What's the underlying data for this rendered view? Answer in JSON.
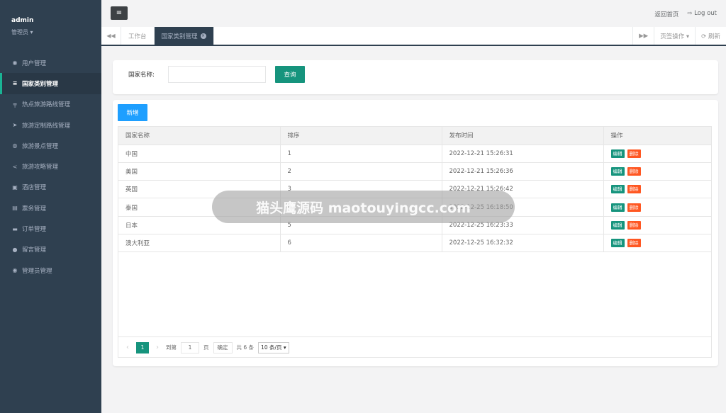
{
  "profile": {
    "name": "admin",
    "role": "管理员 ▾"
  },
  "sidebar": {
    "items": [
      {
        "label": "用户管理",
        "icon": "user-icon",
        "glyph": "◉"
      },
      {
        "label": "国家类别管理",
        "icon": "sliders-icon",
        "glyph": "≡"
      },
      {
        "label": "热点旅游路线管理",
        "icon": "signpost-icon",
        "glyph": "╤"
      },
      {
        "label": "旅游定制路线管理",
        "icon": "paper-plane-icon",
        "glyph": "➤"
      },
      {
        "label": "旅游景点管理",
        "icon": "map-pin-icon",
        "glyph": "◍"
      },
      {
        "label": "旅游攻略管理",
        "icon": "share-icon",
        "glyph": "<"
      },
      {
        "label": "酒店管理",
        "icon": "car-icon",
        "glyph": "▣"
      },
      {
        "label": "票务管理",
        "icon": "id-card-icon",
        "glyph": "▤"
      },
      {
        "label": "订单管理",
        "icon": "credit-card-icon",
        "glyph": "▬"
      },
      {
        "label": "留言管理",
        "icon": "comment-icon",
        "glyph": "●"
      },
      {
        "label": "管理员管理",
        "icon": "user-circle-icon",
        "glyph": "◉"
      }
    ],
    "active_index": 1
  },
  "topbar": {
    "menu_glyph": "≡",
    "home_link": "返回首页",
    "logout": "⇨ Log out"
  },
  "tabs": {
    "prev_glyph": "◀◀",
    "items": [
      {
        "label": "工作台"
      },
      {
        "label": "国家类别管理"
      }
    ],
    "close_glyph": "×",
    "next_glyph": "▶▶",
    "page_ops": "页签操作 ▾",
    "refresh": "⟳ 刷新"
  },
  "search": {
    "label": "国家名称:",
    "value": "",
    "button": "查询"
  },
  "table": {
    "add_button": "新增",
    "columns": [
      "国家名称",
      "排序",
      "发布时间",
      "操作"
    ],
    "rows": [
      {
        "name": "中国",
        "order": "1",
        "time": "2022-12-21 15:26:31"
      },
      {
        "name": "美国",
        "order": "2",
        "time": "2022-12-21 15:26:36"
      },
      {
        "name": "英国",
        "order": "3",
        "time": "2022-12-21 15:26:42"
      },
      {
        "name": "泰国",
        "order": "4",
        "time": "2022-12-25 16:18:50"
      },
      {
        "name": "日本",
        "order": "5",
        "time": "2022-12-25 16:23:33"
      },
      {
        "name": "澳大利亚",
        "order": "6",
        "time": "2022-12-25 16:32:32"
      }
    ],
    "edit_label": "编辑",
    "delete_label": "删除"
  },
  "pager": {
    "prev": "‹",
    "next": "›",
    "current": "1",
    "goto_label": "到第",
    "goto_value": "1",
    "page_label": "页",
    "confirm": "确定",
    "total": "共 6 条",
    "page_size": "10 条/页 ▾"
  },
  "watermark": "猫头鹰源码 maotouyingcc.com",
  "colors": {
    "sidebar": "#2f4050",
    "primary": "#16947d",
    "blue": "#1e9fff",
    "danger": "#ff5722"
  }
}
